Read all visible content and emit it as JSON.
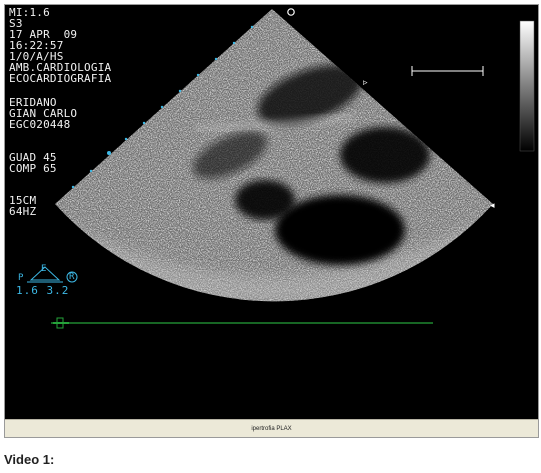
{
  "overlay": {
    "mi": "MI:1.6",
    "probe": "S3",
    "date": "17 APR  09",
    "time": "16:22:57",
    "mode": "1/0/A/HS",
    "department1": "AMB.CARDIOLOGIA",
    "department2": "ECOCARDIOGRAFIA",
    "patient_last": "ERIDANO",
    "patient_first": "GIAN CARLO",
    "patient_id": "EGC020448",
    "gain": "GUAD 45",
    "compression": "COMP 65",
    "depth": "15CM",
    "frame_rate": "64HZ",
    "freq_top_left": "P",
    "freq_top_mid": "E",
    "freq_r": "R",
    "freq_values": "1.6 3.2"
  },
  "status_bar": {
    "label": "ipertrofia PLAX"
  },
  "caption": "Video 1:",
  "colors": {
    "overlay_text": "#f2f2f2",
    "accent_blue": "#3db9e6",
    "ecg_line": "#25a33a",
    "status_bg": "#ece9d8"
  }
}
